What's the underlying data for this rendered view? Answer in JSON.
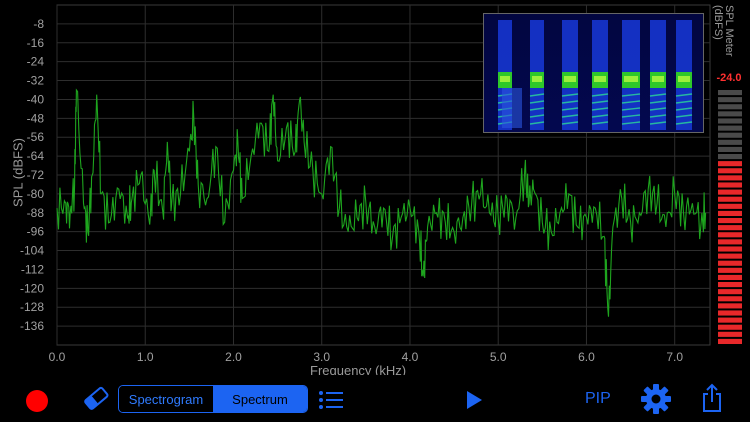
{
  "plot": {
    "y_axis_label": "SPL (dBFS)",
    "x_axis_label": "Frequency (kHz)",
    "y_ticks": [
      "-8",
      "-16",
      "-24",
      "-32",
      "-40",
      "-48",
      "-56",
      "-64",
      "-72",
      "-80",
      "-88",
      "-96",
      "-104",
      "-112",
      "-120",
      "-128",
      "-136"
    ],
    "x_ticks": [
      "0.0",
      "1.0",
      "2.0",
      "3.0",
      "4.0",
      "5.0",
      "6.0",
      "7.0"
    ],
    "trace_color": "#1ea51e",
    "grid_color": "#2e2e2e"
  },
  "chart_data": {
    "type": "line",
    "xlabel": "Frequency (kHz)",
    "ylabel": "SPL (dBFS)",
    "xlim": [
      0,
      7.4
    ],
    "ylim": [
      -144,
      0
    ],
    "series": [
      {
        "x": [
          0.0,
          0.1,
          0.15,
          0.2,
          0.22,
          0.3,
          0.35,
          0.4,
          0.45,
          0.5,
          0.6,
          0.7,
          0.8,
          0.85,
          0.95,
          1.05,
          1.1,
          1.2,
          1.25,
          1.3,
          1.4,
          1.5,
          1.55,
          1.6,
          1.7,
          1.8,
          1.9,
          2.0,
          2.05,
          2.1,
          2.2,
          2.3,
          2.4,
          2.45,
          2.5,
          2.6,
          2.7,
          2.75,
          2.8,
          2.9,
          3.0,
          3.1,
          3.2,
          3.3,
          3.4,
          3.5,
          3.6,
          3.7,
          3.8,
          3.9,
          4.0,
          4.1,
          4.15,
          4.2,
          4.3,
          4.4,
          4.5,
          4.6,
          4.7,
          4.8,
          4.9,
          5.0,
          5.1,
          5.2,
          5.3,
          5.35,
          5.4,
          5.5,
          5.6,
          5.7,
          5.8,
          5.9,
          6.0,
          6.1,
          6.2,
          6.25,
          6.3,
          6.4,
          6.5,
          6.6,
          6.7,
          6.8,
          6.9,
          7.0,
          7.1,
          7.2,
          7.3,
          7.35
        ],
        "y": [
          -86,
          -84,
          -88,
          -76,
          -36,
          -84,
          -96,
          -72,
          -38,
          -80,
          -92,
          -78,
          -90,
          -82,
          -72,
          -93,
          -70,
          -88,
          -58,
          -84,
          -80,
          -62,
          -48,
          -76,
          -82,
          -60,
          -92,
          -70,
          -58,
          -82,
          -64,
          -50,
          -62,
          -38,
          -66,
          -52,
          -62,
          -40,
          -58,
          -70,
          -80,
          -60,
          -86,
          -96,
          -90,
          -84,
          -94,
          -86,
          -99,
          -90,
          -86,
          -96,
          -115,
          -94,
          -88,
          -92,
          -96,
          -90,
          -84,
          -80,
          -88,
          -90,
          -82,
          -90,
          -70,
          -84,
          -78,
          -92,
          -96,
          -88,
          -80,
          -94,
          -90,
          -86,
          -98,
          -132,
          -94,
          -82,
          -92,
          -88,
          -78,
          -84,
          -94,
          -80,
          -88,
          -84,
          -92,
          -88
        ]
      }
    ]
  },
  "meter": {
    "title": "SPL Meter (dBFS)",
    "value": "-24.0",
    "segments_total": 36,
    "segments_lit": 26,
    "lit_color": "#e8282a",
    "unlit_color": "#4a4a4a"
  },
  "toolbar": {
    "record_icon": "record-icon",
    "eraser_icon": "eraser-icon",
    "segment": {
      "left_label": "Spectrogram",
      "right_label": "Spectrum",
      "selected": "Spectrum"
    },
    "list_icon": "list-icon",
    "play_icon": "play-icon",
    "pip_label": "PIP",
    "settings_icon": "gear-icon",
    "share_icon": "share-icon",
    "accent": "#1c64f2",
    "record_color": "#ff0000"
  }
}
